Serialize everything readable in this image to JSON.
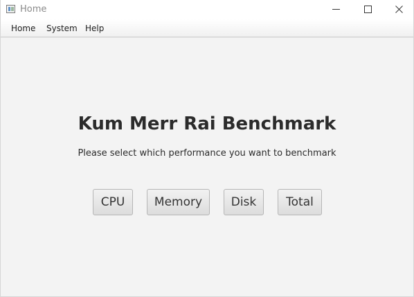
{
  "window": {
    "title": "Home"
  },
  "menubar": {
    "items": [
      {
        "label": "Home"
      },
      {
        "label": "System"
      },
      {
        "label": "Help"
      }
    ]
  },
  "main": {
    "heading": "Kum Merr Rai Benchmark",
    "subtitle": "Please select which performance you want to benchmark",
    "buttons": [
      {
        "label": "CPU"
      },
      {
        "label": "Memory"
      },
      {
        "label": "Disk"
      },
      {
        "label": "Total"
      }
    ]
  }
}
